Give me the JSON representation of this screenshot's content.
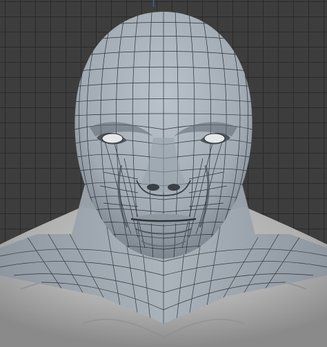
{
  "viewport": {
    "background_color": "#3d3d3d",
    "grid_line_color": "#2a2a2a",
    "axis_color": "#3f6fb5"
  },
  "model": {
    "subject": "head-and-torso-bust",
    "surface_color": "#a7b0b8",
    "shadow_color": "#5e6770",
    "torso_color": "#b3b3b3",
    "wire_color": "#1d2226"
  }
}
